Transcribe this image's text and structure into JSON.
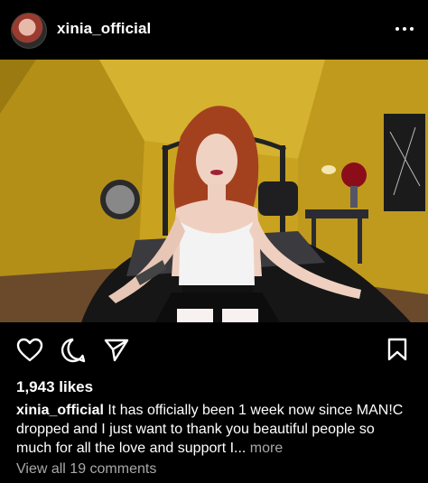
{
  "post": {
    "username": "xinia_official",
    "likes": "1,943 likes",
    "caption_user": "xinia_official",
    "caption_text": " It has officially been 1 week now since MAN!C dropped and I just want to thank you beautiful people so much for all the love and support I...",
    "more_label": " more",
    "view_comments": "View all 19 comments"
  },
  "icons": {
    "more": "more-horizontal-icon",
    "like": "heart-icon",
    "comment": "comment-icon",
    "share": "send-icon",
    "save": "bookmark-icon"
  },
  "colors": {
    "background": "#000000",
    "text": "#ffffff",
    "muted": "#a8a8a8",
    "wall": "#c9a31f"
  }
}
